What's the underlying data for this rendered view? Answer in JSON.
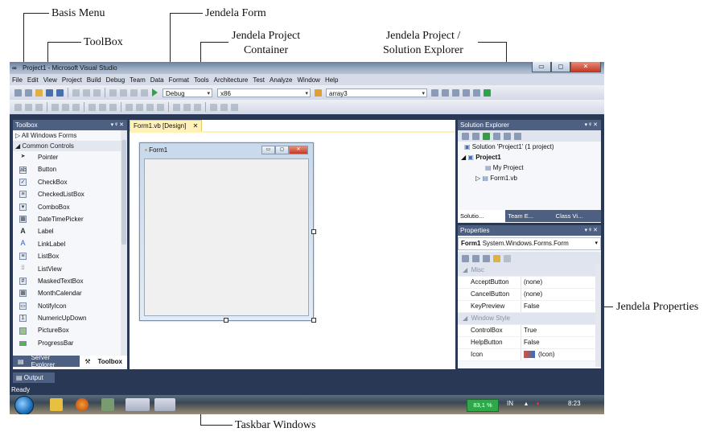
{
  "annotations": {
    "basis_menu": "Basis Menu",
    "jendela_form": "Jendela Form",
    "toolbox": "ToolBox",
    "project_container_line1": "Jendela Project",
    "project_container_line2": "Container",
    "solution_explorer_line1": "Jendela Project /",
    "solution_explorer_line2": "Solution Explorer",
    "properties": "Jendela Properties",
    "taskbar": "Taskbar Windows"
  },
  "window": {
    "title": "Project1 - Microsoft Visual Studio",
    "min_label": "▭",
    "max_label": "◻",
    "close_label": "✕"
  },
  "menu": [
    "File",
    "Edit",
    "View",
    "Project",
    "Build",
    "Debug",
    "Team",
    "Data",
    "Format",
    "Tools",
    "Architecture",
    "Test",
    "Analyze",
    "Window",
    "Help"
  ],
  "toolbar": {
    "config": "Debug",
    "platform": "x86",
    "find": "array3"
  },
  "toolbox": {
    "title": "Toolbox",
    "controls": "▾ ᵠ ✕",
    "groups": [
      "▷ All Windows Forms",
      "◢ Common Controls"
    ],
    "items": [
      "Pointer",
      "Button",
      "CheckBox",
      "CheckedListBox",
      "ComboBox",
      "DateTimePicker",
      "Label",
      "LinkLabel",
      "ListBox",
      "ListView",
      "MaskedTextBox",
      "MonthCalendar",
      "NotifyIcon",
      "NumericUpDown",
      "PictureBox",
      "ProgressBar"
    ],
    "tabs": [
      "Server Explorer",
      "Toolbox"
    ]
  },
  "editor": {
    "tab": "Form1.vb [Design]",
    "tab_close": "✕",
    "form_title": "Form1"
  },
  "solution": {
    "title": "Solution Explorer",
    "controls": "▾ ᵠ ✕",
    "tree": [
      "Solution 'Project1' (1 project)",
      "Project1",
      "My Project",
      "Form1.vb"
    ],
    "tabs": [
      "Solutio...",
      "Team E...",
      "Class Vi..."
    ]
  },
  "properties": {
    "title": "Properties",
    "controls": "▾ ᵠ ✕",
    "object_bold": "Form1",
    "object_type": "System.Windows.Forms.Form",
    "categories": [
      "Misc",
      "Window Style"
    ],
    "misc_rows": [
      {
        "k": "AcceptButton",
        "v": "(none)"
      },
      {
        "k": "CancelButton",
        "v": "(none)"
      },
      {
        "k": "KeyPreview",
        "v": "False"
      }
    ],
    "style_rows": [
      {
        "k": "ControlBox",
        "v": "True"
      },
      {
        "k": "HelpButton",
        "v": "False"
      },
      {
        "k": "Icon",
        "v": "(Icon)"
      }
    ]
  },
  "output": "Output",
  "status": "Ready",
  "taskbar": {
    "battery": "83,1 %",
    "lang": "IN",
    "time": "8:23"
  }
}
